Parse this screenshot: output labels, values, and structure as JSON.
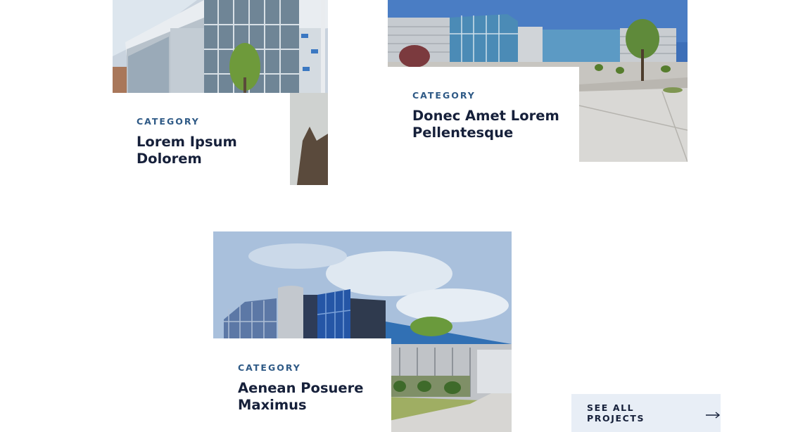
{
  "projects": [
    {
      "category": "CATEGORY",
      "title": "Lorem Ipsum Dolorem",
      "photo": "building-photo"
    },
    {
      "category": "CATEGORY",
      "title": "Donec Amet Lorem Pellentesque",
      "photo": "building-photo"
    },
    {
      "category": "CATEGORY",
      "title": "Aenean Posuere Maximus",
      "photo": "building-photo"
    }
  ],
  "see_all": {
    "label": "SEE ALL PROJECTS",
    "icon": "arrow-right-icon"
  },
  "colors": {
    "accent": "#2f5a86",
    "title_text": "#16203a",
    "button_bg": "#e8eef6",
    "background": "#ffffff"
  }
}
